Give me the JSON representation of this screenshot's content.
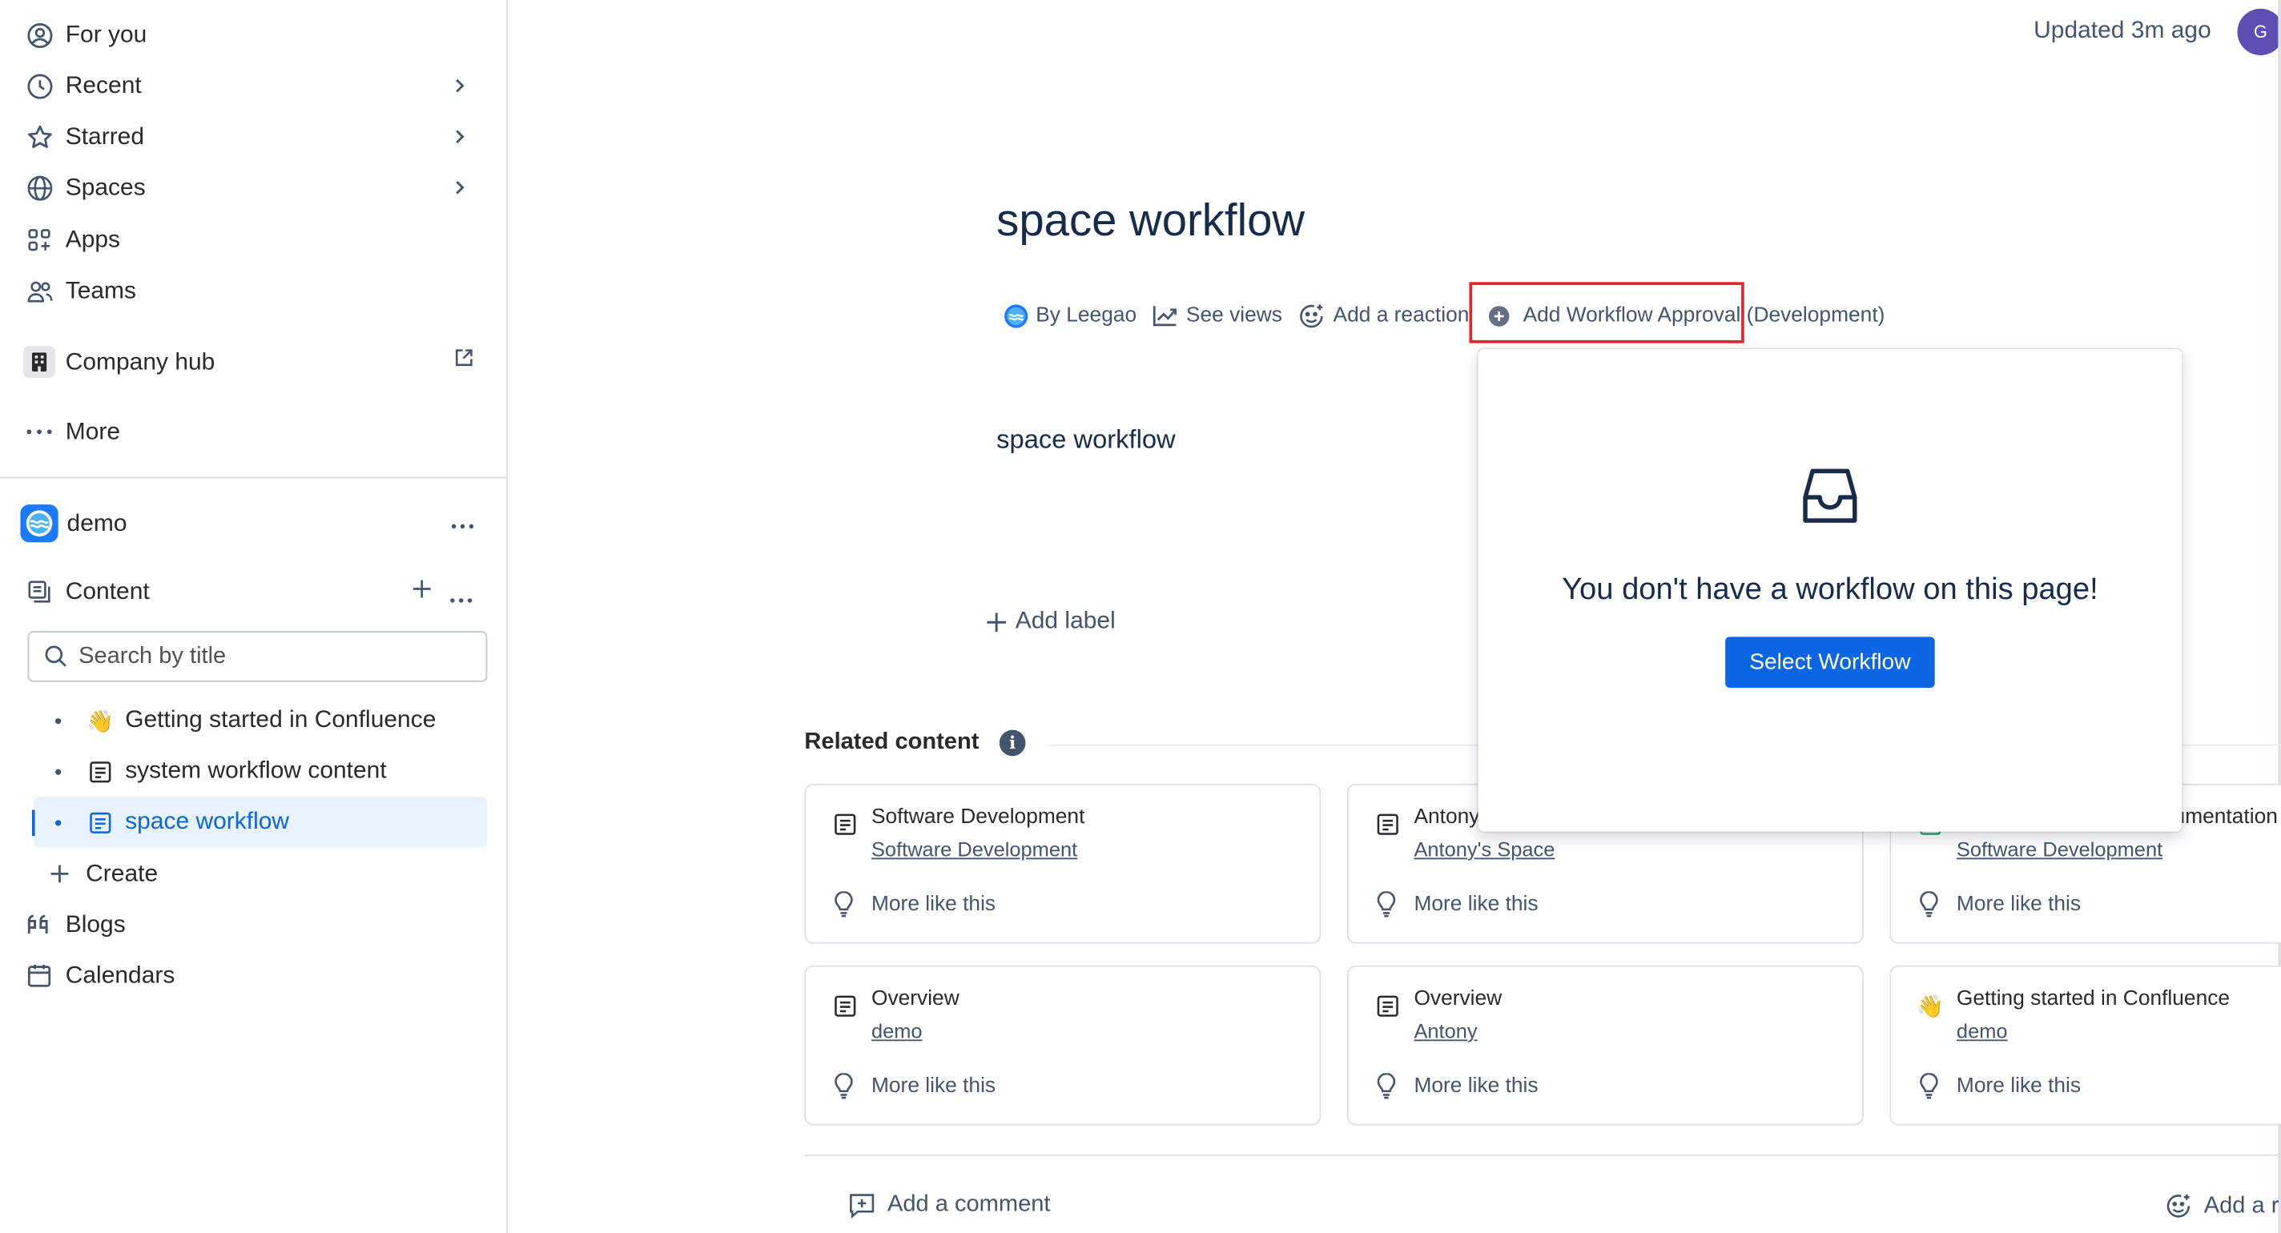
{
  "sidebar": {
    "nav": [
      {
        "label": "For you",
        "icon": "user-circle-icon"
      },
      {
        "label": "Recent",
        "icon": "clock-icon"
      },
      {
        "label": "Starred",
        "icon": "star-icon"
      },
      {
        "label": "Spaces",
        "icon": "globe-icon"
      },
      {
        "label": "Apps",
        "icon": "apps-icon"
      },
      {
        "label": "Teams",
        "icon": "people-icon"
      }
    ],
    "company_hub": "Company hub",
    "more": "More",
    "space_name": "demo",
    "content_label": "Content",
    "search_placeholder": "Search by title",
    "tree": [
      {
        "label": "Getting started in Confluence",
        "icon": "wave-emoji-icon",
        "emoji": "👋"
      },
      {
        "label": "system workflow content",
        "icon": "page-icon"
      },
      {
        "label": "space workflow",
        "icon": "page-icon"
      }
    ],
    "create": "Create",
    "blogs": "Blogs",
    "calendars": "Calendars"
  },
  "header": {
    "updated": "Updated 3m ago",
    "avatar_initial": "G"
  },
  "page": {
    "title": "space workflow",
    "byline": {
      "author": "By Leegao",
      "views": "See views",
      "reaction": "Add a reaction",
      "workflow": "Add Workflow Approval (Development)"
    },
    "body": "space workflow",
    "add_label": "Add label",
    "related_title": "Related content",
    "related_info": "i",
    "cards": [
      {
        "title": "Software Development",
        "space": "Software Development",
        "more": "More like this",
        "icon": "page-icon"
      },
      {
        "title": "Antony",
        "space": "Antony's Space",
        "more": "More like this",
        "icon": "page-icon"
      },
      {
        "title": "umentation",
        "space": "Software Development",
        "more": "More like this",
        "icon": "page-icon"
      },
      {
        "title": "Overview",
        "space": "demo",
        "more": "More like this",
        "icon": "page-icon"
      },
      {
        "title": "Overview",
        "space": "Antony",
        "more": "More like this",
        "icon": "page-icon"
      },
      {
        "title": "Getting started in Confluence",
        "space": "demo",
        "more": "More like this",
        "icon": "wave-emoji-icon"
      }
    ],
    "add_comment": "Add a comment",
    "add_reaction_bottom": "Add a r"
  },
  "popup": {
    "message": "You don't have a workflow on this page!",
    "button": "Select Workflow",
    "icon": "inbox-icon"
  },
  "colors": {
    "accent": "#0c66e4",
    "highlight": "#e0262b",
    "active_bg": "#e9f2ff"
  }
}
